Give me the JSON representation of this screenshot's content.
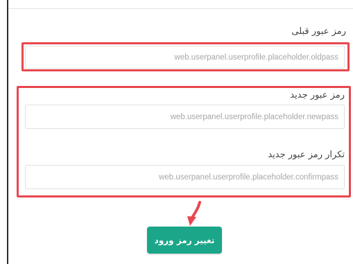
{
  "form": {
    "old_password": {
      "label": "رمز عبور قبلی",
      "placeholder": "web.userpanel.userprofile.placeholder.oldpass"
    },
    "new_password": {
      "label": "رمز عبور جدید",
      "placeholder": "web.userpanel.userprofile.placeholder.newpass"
    },
    "confirm_password": {
      "label": "تکرار رمز عبور جدید",
      "placeholder": "web.userpanel.userprofile.placeholder.confirmpass"
    },
    "submit_label": "تغییر رمز ورود"
  },
  "colors": {
    "accent": "#1ba689",
    "highlight": "#e8474e"
  },
  "icons": {
    "pointer": "arrow-pointer-icon"
  }
}
